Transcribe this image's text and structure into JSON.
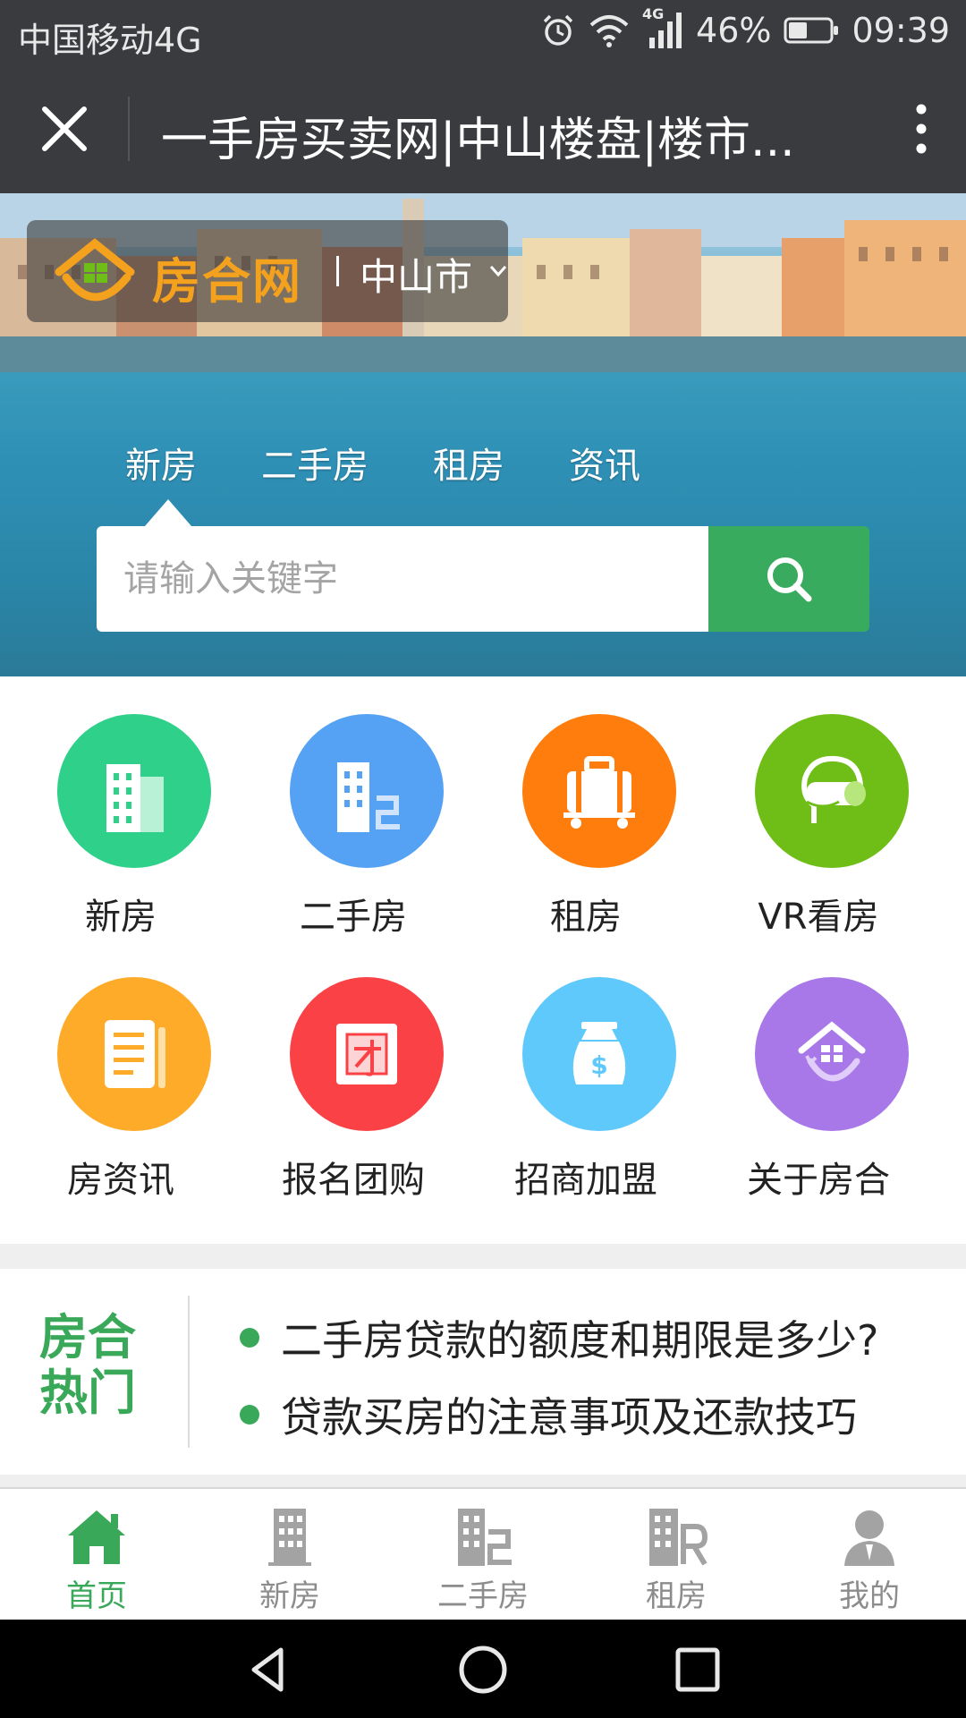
{
  "status_bar": {
    "carrier": "中国移动4G",
    "network_badge": "4G",
    "battery": "46%",
    "time": "09:39"
  },
  "title_bar": {
    "title": "一手房买卖网|中山楼盘|楼市..."
  },
  "hero": {
    "brand_name": "房合网",
    "city": "中山市",
    "tabs": [
      "新房",
      "二手房",
      "租房",
      "资讯"
    ],
    "search_placeholder": "请输入关键字"
  },
  "grid": [
    {
      "label": "新房",
      "icon": "building-icon",
      "color": "#2fd08a"
    },
    {
      "label": "二手房",
      "icon": "second-hand-building-icon",
      "color": "#55a2f5"
    },
    {
      "label": "租房",
      "icon": "suitcase-icon",
      "color": "#ff7d0c"
    },
    {
      "label": "VR看房",
      "icon": "vr-headset-icon",
      "color": "#6fbe17"
    },
    {
      "label": "房资讯",
      "icon": "document-icon",
      "color": "#ffab2a"
    },
    {
      "label": "报名团购",
      "icon": "group-buy-icon",
      "color": "#fa4246"
    },
    {
      "label": "招商加盟",
      "icon": "money-bag-icon",
      "color": "#5fc9fb"
    },
    {
      "label": "关于房合",
      "icon": "house-icon",
      "color": "#a878e8"
    }
  ],
  "hot": {
    "badge": "房合热门",
    "items": [
      "二手房贷款的额度和期限是多少?",
      "贷款买房的注意事项及还款技巧"
    ]
  },
  "tabbar": [
    {
      "label": "首页",
      "icon": "home-icon",
      "active": true
    },
    {
      "label": "新房",
      "icon": "building-icon",
      "active": false
    },
    {
      "label": "二手房",
      "icon": "second-hand-building-icon",
      "active": false
    },
    {
      "label": "租房",
      "icon": "rent-building-icon",
      "active": false
    },
    {
      "label": "我的",
      "icon": "user-icon",
      "active": false
    }
  ],
  "colors": {
    "accent": "#39ab5f",
    "title_bar": "#3a3b3f",
    "logo_orange": "#f4a21d"
  }
}
